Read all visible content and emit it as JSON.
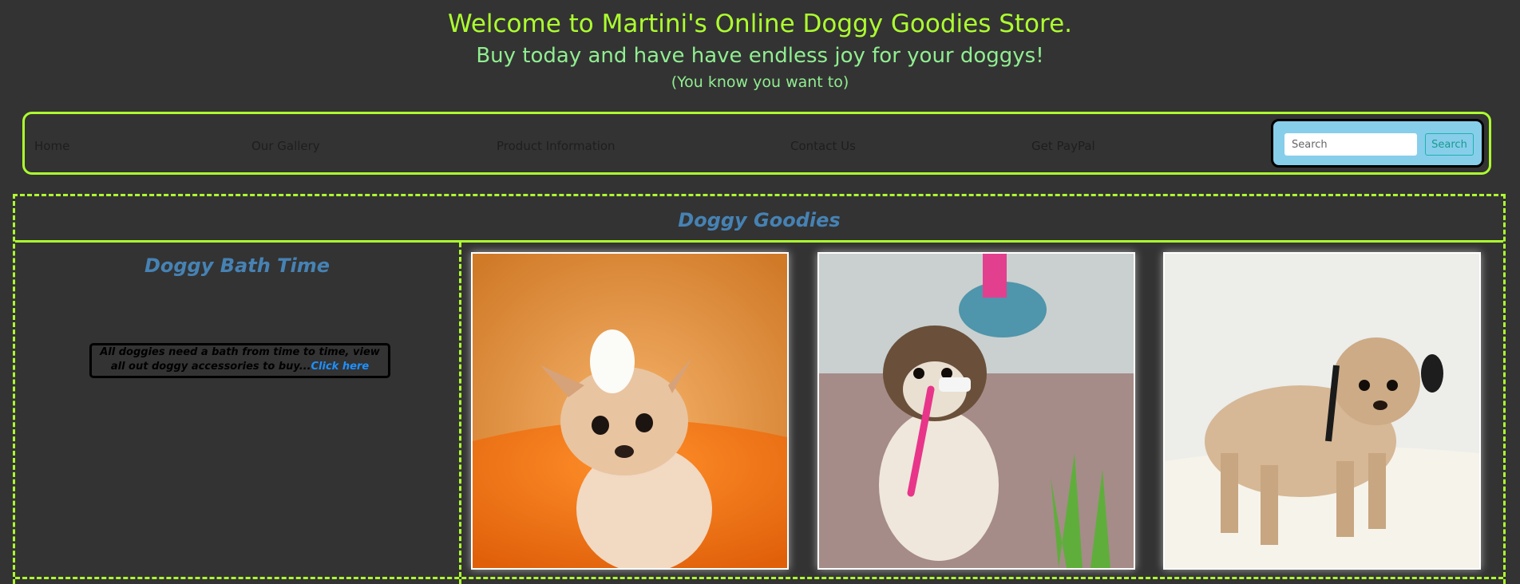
{
  "header": {
    "title": "Welcome to Martini's Online Doggy Goodies Store.",
    "subtitle": "Buy today and have have endless joy for your doggys!",
    "aside": "(You know you want to)"
  },
  "nav": {
    "items": [
      "Home",
      "Our Gallery",
      "Product Information",
      "Contact Us",
      "Get PayPal"
    ]
  },
  "search": {
    "placeholder": "Search",
    "button_label": "Search"
  },
  "main": {
    "title": "Doggy Goodies",
    "left": {
      "title": "Doggy Bath Time",
      "text": "All doggies need a bath from time to time, view all out doggy accessories to buy...",
      "link": "Click here"
    },
    "photos": [
      {
        "subject": "chihuahua-with-foam-in-orange-tub"
      },
      {
        "subject": "shih-tzu-holding-pink-brush"
      },
      {
        "subject": "wet-poodle-in-bathtub"
      }
    ]
  },
  "colors": {
    "background": "#333333",
    "title": "#adff2f",
    "subtitle": "#90ee90",
    "section_heading": "#4682b4",
    "border": "#adff2f",
    "search_panel": "#87ceeb",
    "link": "#1e90ff"
  }
}
